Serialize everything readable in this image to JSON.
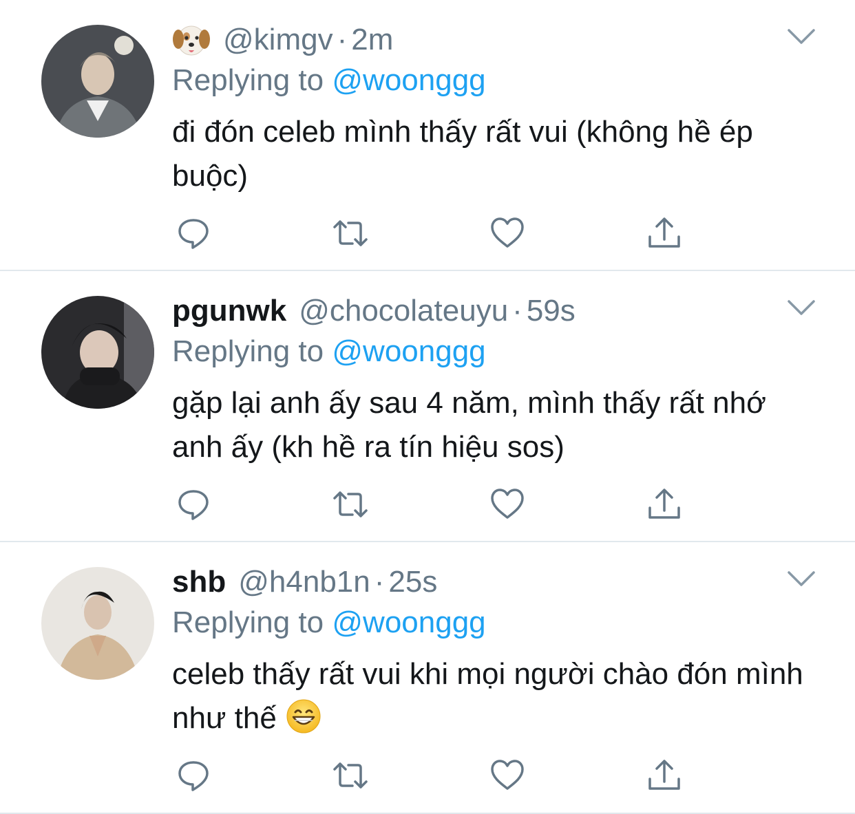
{
  "tweets": [
    {
      "display_name": "",
      "name_emoji": "dog-face",
      "handle": "@kimgv",
      "dot": "·",
      "time": "2m",
      "replying_prefix": "Replying to",
      "mention": "@woonggg",
      "text": "đi đón celeb mình thấy rất vui (không hề ép buộc)",
      "avatar_bg": "#4a4d52"
    },
    {
      "display_name": "pgunwk",
      "handle": "@chocolateuyu",
      "dot": "·",
      "time": "59s",
      "replying_prefix": "Replying to",
      "mention": "@woonggg",
      "text": "gặp lại anh ấy sau 4 năm, mình thấy rất nhớ anh ấy (kh hề ra tín hiệu sos)",
      "avatar_bg": "#2b2b2e"
    },
    {
      "display_name": "shb",
      "handle": "@h4nb1n",
      "dot": "·",
      "time": "25s",
      "replying_prefix": "Replying to",
      "mention": "@woonggg",
      "text": "celeb thấy rất vui khi mọi người chào đón mình như thế",
      "trailing_emoji": "grinning-face",
      "avatar_bg": "#e9e6e1"
    }
  ],
  "actions": [
    "reply-icon",
    "retweet-icon",
    "like-icon",
    "share-icon"
  ],
  "colors": {
    "link": "#1da1f2",
    "muted": "#657786",
    "text": "#14171a",
    "divider": "#e1e8ed"
  }
}
